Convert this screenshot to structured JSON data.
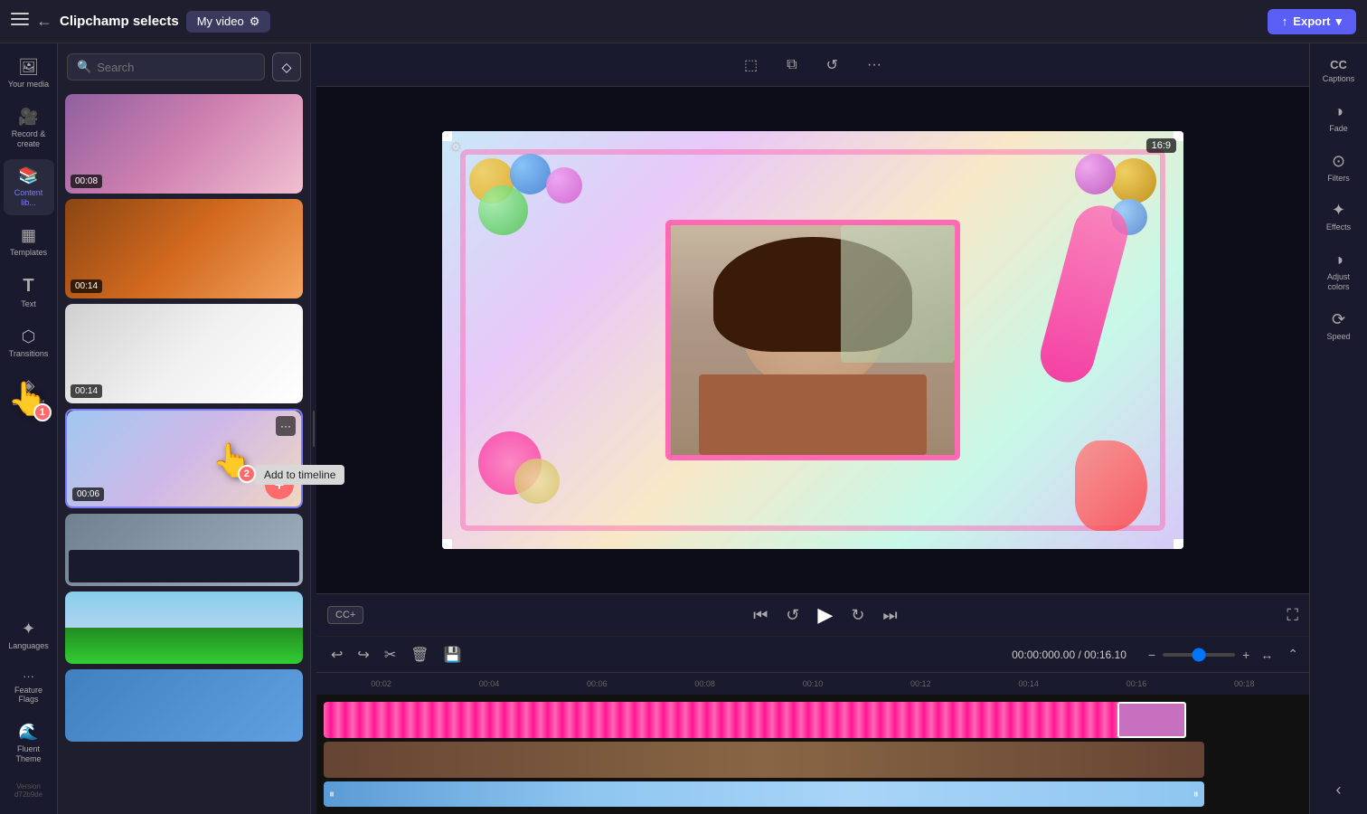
{
  "app": {
    "title": "Clipchamp selects",
    "back_label": "←",
    "hamburger": "≡"
  },
  "topbar": {
    "tab_my_video": "My video",
    "export_label": "Export",
    "export_icon": "↑"
  },
  "sidebar": {
    "items": [
      {
        "id": "your-media",
        "icon": "🖼",
        "label": "Your media"
      },
      {
        "id": "record-create",
        "icon": "🎥",
        "label": "Record &\ncreate"
      },
      {
        "id": "content-library",
        "icon": "📚",
        "label": "Content lib..."
      },
      {
        "id": "templates",
        "icon": "▦",
        "label": "Templates"
      },
      {
        "id": "text",
        "icon": "T",
        "label": "Text"
      },
      {
        "id": "transitions",
        "icon": "⬡",
        "label": "Transitions"
      },
      {
        "id": "brand-kit",
        "icon": "◈",
        "label": "Brand kit"
      },
      {
        "id": "languages",
        "icon": "✦",
        "label": "Languages"
      },
      {
        "id": "feature-flags",
        "icon": "···",
        "label": "Feature Flags"
      },
      {
        "id": "fluent-theme",
        "icon": "🌊",
        "label": "Fluent Theme"
      },
      {
        "id": "version",
        "icon": "·",
        "label": "Version d72b9de"
      }
    ]
  },
  "media_panel": {
    "search_placeholder": "Search",
    "diamond_icon": "◇",
    "thumbs": [
      {
        "duration": "00:08",
        "color1": "#c8a0c8",
        "color2": "#e8c8d8"
      },
      {
        "duration": "00:14",
        "color1": "#c87840",
        "color2": "#e8a860"
      },
      {
        "duration": "00:14",
        "color1": "#d8d8d8",
        "color2": "#f0f0f0"
      },
      {
        "duration": "00:06",
        "color1": "#a0c8e8",
        "color2": "#c8d8f0",
        "has_menu": true,
        "has_add": true
      },
      {
        "duration": "",
        "color1": "#a8b8c8",
        "color2": "#c8d0d8"
      },
      {
        "duration": "",
        "color1": "#60a040",
        "color2": "#80c060"
      },
      {
        "duration": "",
        "color1": "#80a0c0",
        "color2": "#a0c0e0"
      }
    ]
  },
  "canvas": {
    "ratio": "16:9",
    "time_current": "00:00.00",
    "time_total": "00:16.10"
  },
  "playback": {
    "cc_label": "CC+",
    "rewind_icon": "⏮",
    "back5_icon": "↺",
    "play_icon": "▶",
    "fwd5_icon": "↻",
    "skip_icon": "⏭",
    "fullscreen_icon": "⛶"
  },
  "timeline": {
    "undo_icon": "↩",
    "redo_icon": "↪",
    "cut_icon": "✂",
    "delete_icon": "🗑",
    "save_icon": "💾",
    "time_display": "00:00:000.00 / 00:16.10",
    "zoom_in": "+",
    "zoom_out": "-",
    "collapse": "⌃",
    "ruler_marks": [
      "00:02",
      "00:04",
      "00:06",
      "00:08",
      "00:10",
      "00:12",
      "00:14",
      "00:16",
      "00:18"
    ]
  },
  "right_sidebar": {
    "items": [
      {
        "id": "captions",
        "icon": "CC",
        "label": "Captions"
      },
      {
        "id": "fade",
        "icon": "◑",
        "label": "Fade"
      },
      {
        "id": "filters",
        "icon": "⊙",
        "label": "Filters"
      },
      {
        "id": "effects",
        "icon": "✦",
        "label": "Effects"
      },
      {
        "id": "adjust-colors",
        "icon": "◑",
        "label": "Adjust colors"
      },
      {
        "id": "speed",
        "icon": "⟳",
        "label": "Speed"
      }
    ]
  },
  "tooltip": {
    "add_timeline": "Add to timeline"
  },
  "cursor_badges": {
    "badge1": "1",
    "badge2": "2"
  }
}
